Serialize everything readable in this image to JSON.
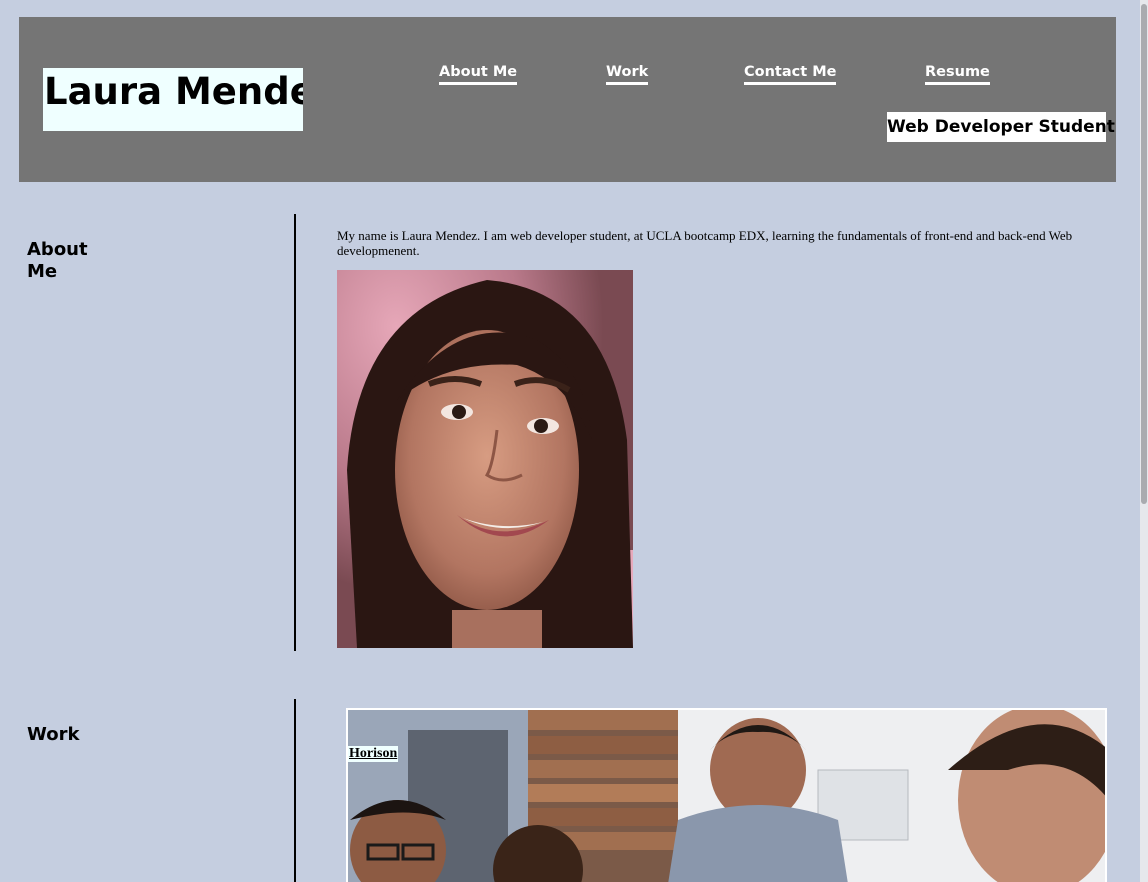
{
  "header": {
    "name": "Laura Mendez",
    "tagline": "Web Developer Student",
    "nav": {
      "about": "About Me",
      "work": "Work",
      "contact": "Contact Me",
      "resume": "Resume"
    }
  },
  "about": {
    "title": "About Me",
    "text": "My name is Laura Mendez. I am web developer student, at UCLA bootcamp EDX, learning the fundamentals of front-end and back-end Web developmenent."
  },
  "work": {
    "title": "Work",
    "project_link": "Horison"
  },
  "colors": {
    "page_bg": "#c5cee0",
    "header_bg": "#757575",
    "brand_bg": "#efffff",
    "nav_text": "#ffffff"
  }
}
